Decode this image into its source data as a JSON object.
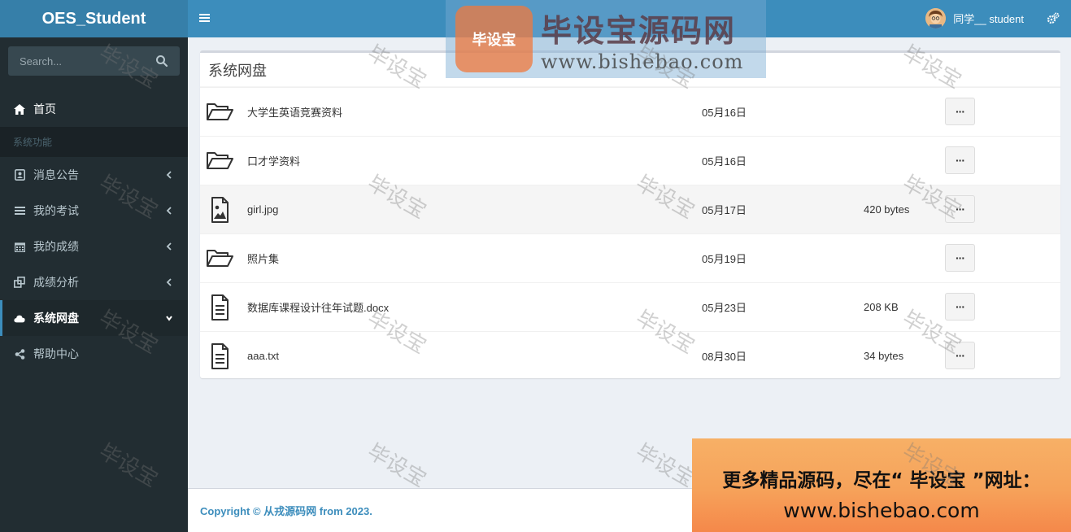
{
  "app": {
    "logo_text": "OES_Student"
  },
  "sidebar": {
    "search_placeholder": "Search...",
    "home_label": "首页",
    "section_header": "系统功能",
    "items": [
      {
        "label": "消息公告",
        "icon": "address-card-icon"
      },
      {
        "label": "我的考试",
        "icon": "list-icon"
      },
      {
        "label": "我的成绩",
        "icon": "calendar-icon"
      },
      {
        "label": "成绩分析",
        "icon": "clone-icon"
      },
      {
        "label": "系统网盘",
        "icon": "cloud-icon"
      },
      {
        "label": "帮助中心",
        "icon": "share-icon"
      }
    ],
    "active_index": 4
  },
  "header": {
    "user_name": "同学__ student"
  },
  "box": {
    "title": "系统网盘",
    "files": [
      {
        "name": "大学生英语竞赛资料",
        "date": "05月16日",
        "size": "",
        "type": "folder",
        "icon": "folder-open-icon"
      },
      {
        "name": "口才学资料",
        "date": "05月16日",
        "size": "",
        "type": "folder",
        "icon": "folder-open-icon"
      },
      {
        "name": "girl.jpg",
        "date": "05月17日",
        "size": "420 bytes",
        "type": "image",
        "icon": "image-file-icon"
      },
      {
        "name": "照片集",
        "date": "05月19日",
        "size": "",
        "type": "folder",
        "icon": "folder-open-icon"
      },
      {
        "name": "数据库课程设计往年试题.docx",
        "date": "05月23日",
        "size": "208 KB",
        "type": "doc",
        "icon": "text-file-icon"
      },
      {
        "name": "aaa.txt",
        "date": "08月30日",
        "size": "34 bytes",
        "type": "doc",
        "icon": "text-file-icon"
      }
    ],
    "action_label": "···"
  },
  "footer": {
    "copyright": "Copyright © 从戎源码网 from 2023."
  },
  "watermark": {
    "text": "毕设宝",
    "logo_badge": "毕设宝",
    "logo_title": "毕设宝源码网",
    "logo_url": "www.bishebao.com",
    "promo_line1": "更多精品源码，尽在“ 毕设宝 ”网址：",
    "promo_line2": "www.bishebao.com"
  },
  "colors": {
    "header": "#3c8dbc",
    "logo_bg": "#367fa9",
    "sidebar": "#222d32",
    "accent": "#3c8dbc"
  }
}
